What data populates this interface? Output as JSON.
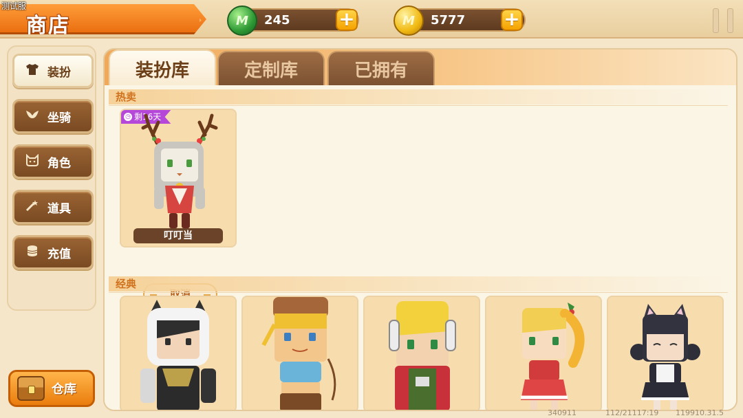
{
  "debug_label": "测试服",
  "header": {
    "title": "商店",
    "currencies": [
      {
        "icon": "green-mini-coin-icon",
        "symbol": "M",
        "amount": "245"
      },
      {
        "icon": "gold-mini-coin-icon",
        "symbol": "M",
        "amount": "5777"
      }
    ],
    "plus_label": "+"
  },
  "sidebar": {
    "items": [
      {
        "label": "装扮",
        "icon": "shirt-icon",
        "active": true
      },
      {
        "label": "坐骑",
        "icon": "wings-icon",
        "active": false
      },
      {
        "label": "角色",
        "icon": "cat-face-icon",
        "active": false
      },
      {
        "label": "道具",
        "icon": "magic-wand-icon",
        "active": false
      },
      {
        "label": "充值",
        "icon": "coin-stack-icon",
        "active": false
      }
    ],
    "warehouse_label": "仓库"
  },
  "tabs": [
    {
      "label": "装扮库",
      "active": true
    },
    {
      "label": "定制库",
      "active": false
    },
    {
      "label": "已拥有",
      "active": false
    }
  ],
  "sections": {
    "hot": {
      "label": "热卖",
      "items": [
        {
          "name": "叮叮当",
          "badge": "剩16天",
          "action": "取消"
        }
      ]
    },
    "classic": {
      "label": "经典",
      "count_visible": 5
    }
  },
  "footer": {
    "left": "340911",
    "mid": "112/21117:19",
    "right": "119910.31.5"
  },
  "colors": {
    "accent_orange": "#ea6f10",
    "panel_bg": "#f4e4c6",
    "card_bg": "#f7dcae",
    "badge_purple": "#b548d9"
  }
}
